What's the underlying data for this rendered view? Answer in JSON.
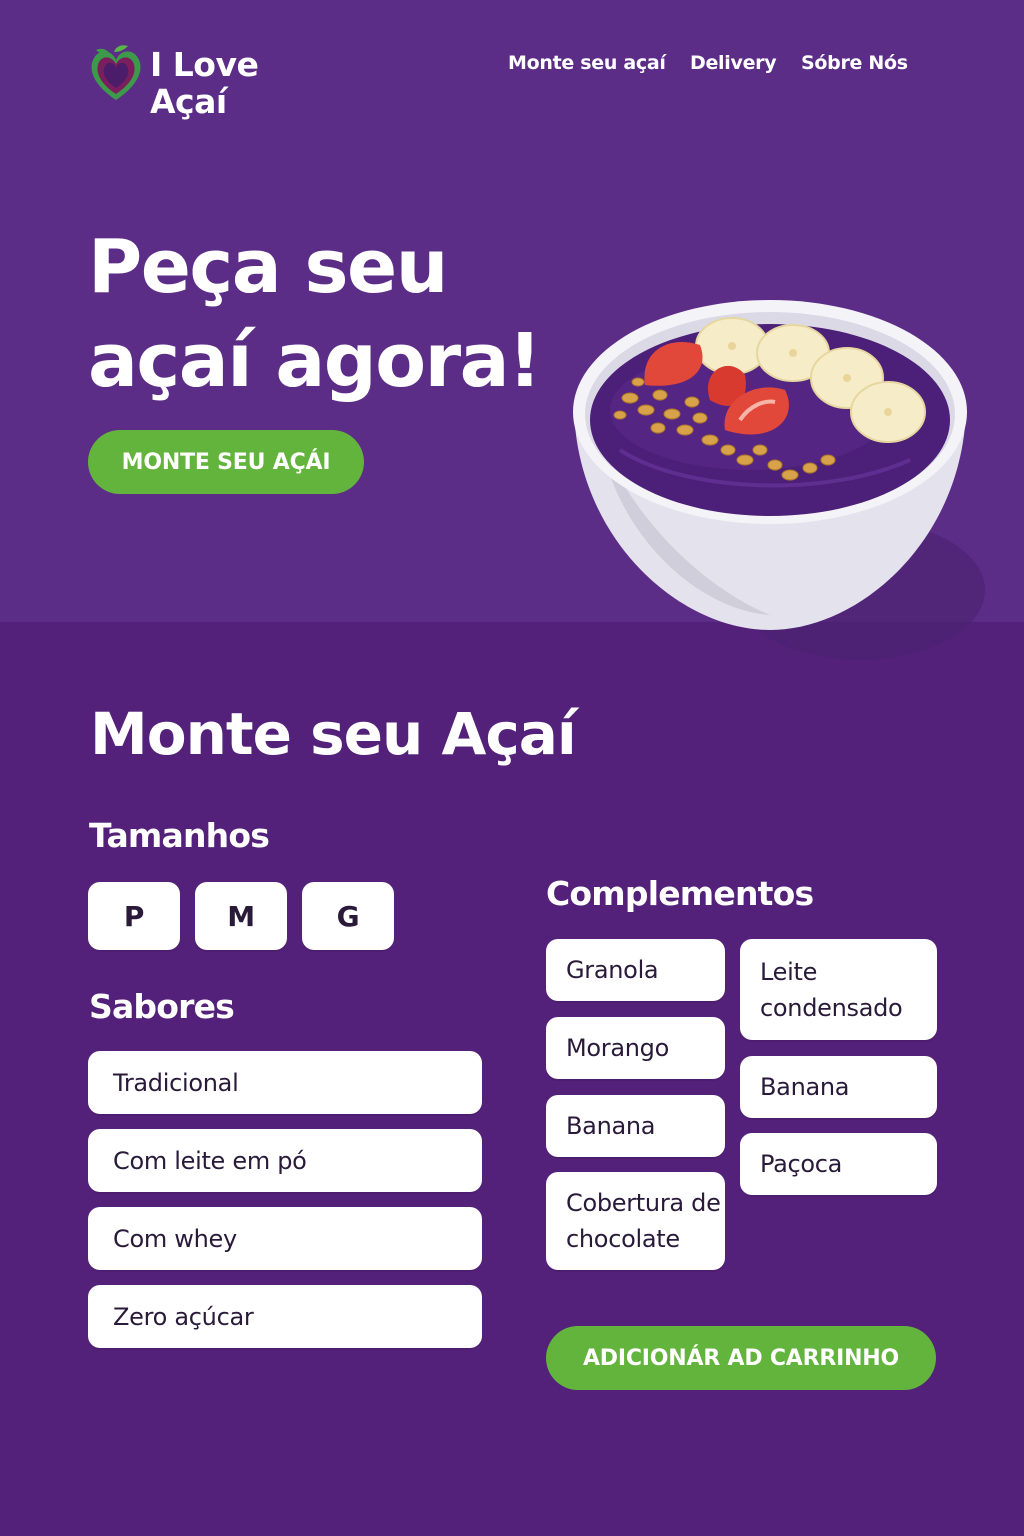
{
  "brand": {
    "line1": "I Love",
    "line2": "Açaí"
  },
  "nav": {
    "items": [
      "Monte seu açaí",
      "Delivery",
      "Sóbre Nós"
    ]
  },
  "hero": {
    "title_line1": "Peça seu",
    "title_line2": "açaí agora!",
    "cta": "MONTE SEU AÇÁI"
  },
  "builder": {
    "title": "Monte seu Açaí",
    "sizes_label": "Tamanhos",
    "sizes": [
      "P",
      "M",
      "G"
    ],
    "flavors_label": "Sabores",
    "flavors": [
      "Tradicional",
      "Com leite em pó",
      "Com whey",
      "Zero açúcar"
    ],
    "complements_label": "Complementos",
    "complements_col1": [
      "Granola",
      "Morango",
      "Banana",
      "Cobertura de chocolate"
    ],
    "complements_col2": [
      "Leite condensado",
      "Banana",
      "Paçoca"
    ],
    "add_to_cart": "ADICIONÁR AD CARRINHO"
  },
  "colors": {
    "hero_bg": "#5c2d87",
    "page_bg": "#54217a",
    "accent_green": "#63b43c",
    "card_bg": "#ffffff"
  },
  "icons": [
    "heart-acai-logo-icon",
    "acai-bowl-image"
  ]
}
